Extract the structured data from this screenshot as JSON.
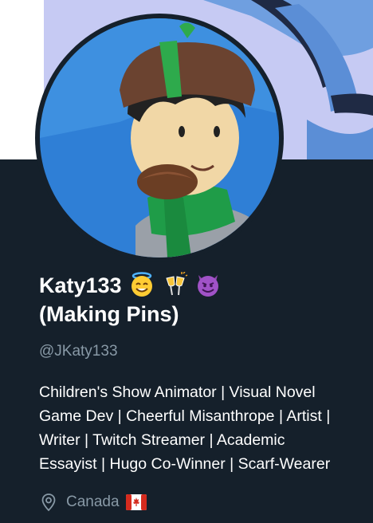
{
  "profile": {
    "display_name_line1": "Katy133",
    "display_name_line2": "(Making Pins)",
    "name_emojis": [
      "smiling-face-with-halo",
      "clinking-glasses",
      "smiling-face-with-horns"
    ],
    "handle": "@JKaty133",
    "bio": "Children's Show Animator | Visual Novel\nGame Dev | Cheerful Misanthrope | Artist |\nWriter | Twitch Streamer | Academic\nEssayist | Hugo Co-Winner | Scarf-Wearer",
    "location": "Canada",
    "location_flag": "flag-canada"
  },
  "colors": {
    "background": "#15202b",
    "text_primary": "#ffffff",
    "text_secondary": "#8899a6",
    "banner_blue": "#5b8ed6",
    "banner_lilac": "#c5c9f2"
  }
}
